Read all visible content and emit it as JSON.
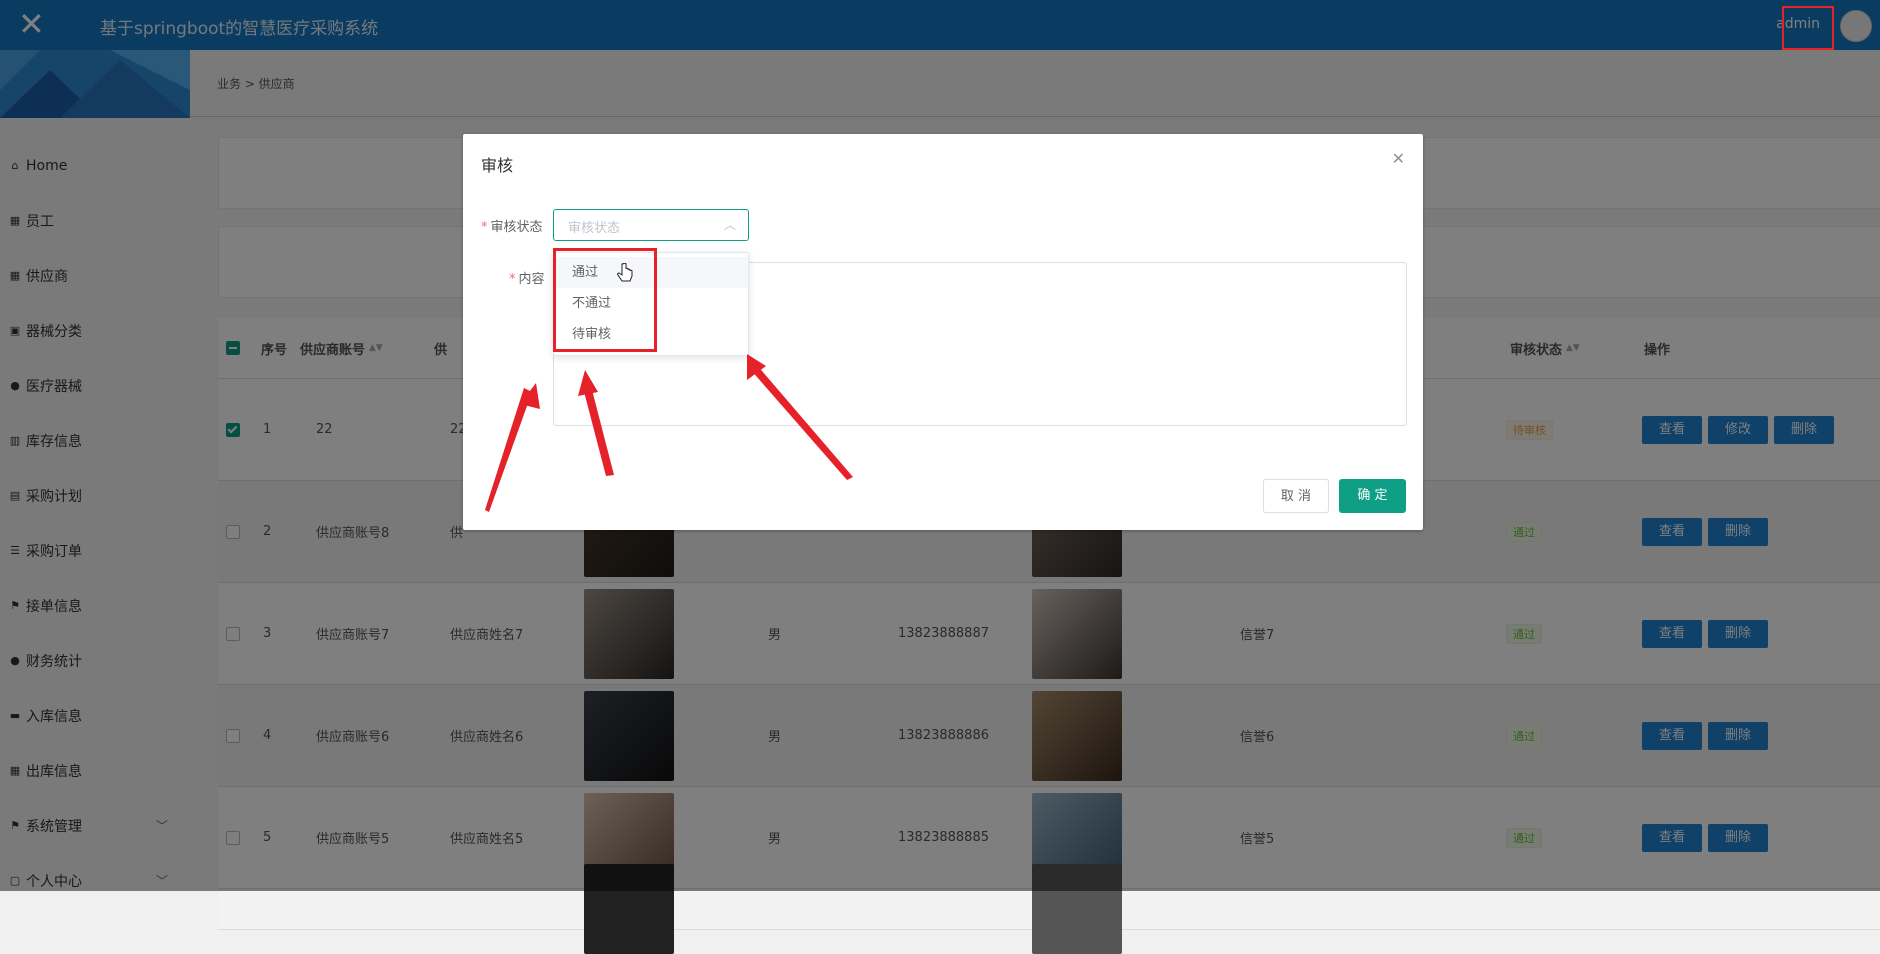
{
  "header": {
    "title": "基于springboot的智慧医疗采购系统",
    "user": "admin"
  },
  "sidebar": {
    "items": [
      {
        "label": "Home",
        "icon": "home-icon"
      },
      {
        "label": "员工",
        "icon": "grid-icon"
      },
      {
        "label": "供应商",
        "icon": "grid-icon"
      },
      {
        "label": "器械分类",
        "icon": "chart-icon"
      },
      {
        "label": "医疗器械",
        "icon": "user-icon"
      },
      {
        "label": "库存信息",
        "icon": "bar-icon"
      },
      {
        "label": "采购计划",
        "icon": "clipboard-icon"
      },
      {
        "label": "采购订单",
        "icon": "list-icon"
      },
      {
        "label": "接单信息",
        "icon": "flag-icon"
      },
      {
        "label": "财务统计",
        "icon": "user-icon"
      },
      {
        "label": "入库信息",
        "icon": "money-icon"
      },
      {
        "label": "出库信息",
        "icon": "grid-icon"
      },
      {
        "label": "系统管理",
        "icon": "flag-icon",
        "has_children": true
      },
      {
        "label": "个人中心",
        "icon": "calendar-icon",
        "has_children": true
      }
    ]
  },
  "breadcrumb": "业务 > 供应商",
  "table": {
    "headers": {
      "index": "序号",
      "account": "供应商账号",
      "name": "供",
      "status": "审核状态",
      "actions": "操作"
    },
    "rows": [
      {
        "index": "1",
        "account": "22",
        "name": "22",
        "gender": "",
        "phone": "",
        "credit": "",
        "status": "待审核",
        "status_type": "wait",
        "checked": true,
        "actions": [
          "查看",
          "修改",
          "删除"
        ]
      },
      {
        "index": "2",
        "account": "供应商账号8",
        "name": "供",
        "gender": "",
        "phone": "",
        "credit": "",
        "status": "通过",
        "status_type": "pass",
        "checked": false,
        "actions": [
          "查看",
          "删除"
        ]
      },
      {
        "index": "3",
        "account": "供应商账号7",
        "name": "供应商姓名7",
        "gender": "男",
        "phone": "13823888887",
        "credit": "信誉7",
        "status": "通过",
        "status_type": "pass",
        "checked": false,
        "actions": [
          "查看",
          "删除"
        ]
      },
      {
        "index": "4",
        "account": "供应商账号6",
        "name": "供应商姓名6",
        "gender": "男",
        "phone": "13823888886",
        "credit": "信誉6",
        "status": "通过",
        "status_type": "pass",
        "checked": false,
        "actions": [
          "查看",
          "删除"
        ]
      },
      {
        "index": "5",
        "account": "供应商账号5",
        "name": "供应商姓名5",
        "gender": "男",
        "phone": "13823888885",
        "credit": "信誉5",
        "status": "通过",
        "status_type": "pass",
        "checked": false,
        "actions": [
          "查看",
          "删除"
        ]
      }
    ]
  },
  "dialog": {
    "title": "审核",
    "status_label": "审核状态",
    "status_placeholder": "审核状态",
    "content_label": "内容",
    "options": [
      "通过",
      "不通过",
      "待审核"
    ],
    "cancel": "取 消",
    "confirm": "确 定"
  },
  "colors": {
    "header": "#1478c3",
    "primary_button": "#1e82d2",
    "accent": "#0f9f86",
    "annotation": "#e5212a"
  }
}
